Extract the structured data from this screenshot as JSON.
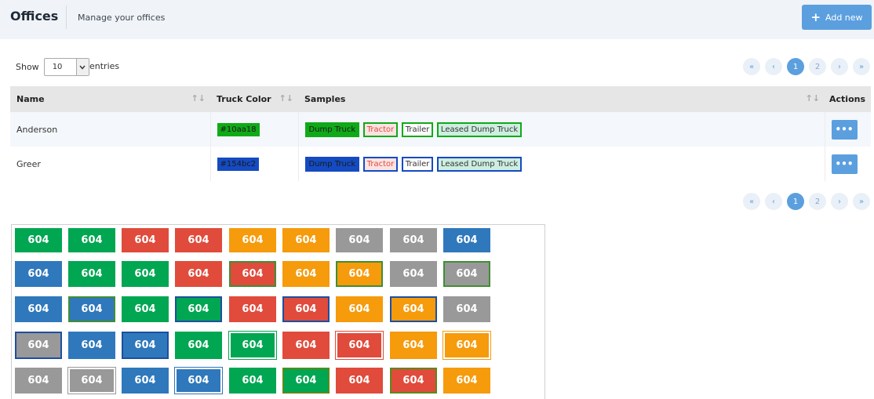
{
  "header": {
    "title": "Offices",
    "subtitle": "Manage your offices",
    "add_button_label": "Add new",
    "add_icon": "plus-icon"
  },
  "length": {
    "show_label": "Show",
    "value": "10",
    "entries_label": "entries"
  },
  "pagination": {
    "first_icon": "«",
    "prev_icon": "‹",
    "pages": [
      "1",
      "2"
    ],
    "active_page": "1",
    "next_icon": "›",
    "last_icon": "»"
  },
  "table": {
    "columns": [
      "Name",
      "Truck Color",
      "Samples",
      "Actions"
    ],
    "rows": [
      {
        "name": "Anderson",
        "truck_color": "#10aa18",
        "chip_bg": "#10aa18",
        "samples": [
          {
            "label": "Dump Truck",
            "bg": "#10aa18",
            "fg": "#1a1a1a",
            "border": "#10aa18"
          },
          {
            "label": "Tractor",
            "bg": "#fbe3e3",
            "fg": "#e04b3c",
            "border": "#10aa18"
          },
          {
            "label": "Trailer",
            "bg": "#ffffff",
            "fg": "#333333",
            "border": "#10aa18"
          },
          {
            "label": "Leased Dump Truck",
            "bg": "#cdeee0",
            "fg": "#333333",
            "border": "#10aa18"
          }
        ],
        "action_label": "•••"
      },
      {
        "name": "Greer",
        "truck_color": "#154bc2",
        "chip_bg": "#154bc2",
        "samples": [
          {
            "label": "Dump Truck",
            "bg": "#154bc2",
            "fg": "#1a1a1a",
            "border": "#154bc2"
          },
          {
            "label": "Tractor",
            "bg": "#fbe3e3",
            "fg": "#e04b3c",
            "border": "#154bc2"
          },
          {
            "label": "Trailer",
            "bg": "#ffffff",
            "fg": "#333333",
            "border": "#154bc2"
          },
          {
            "label": "Leased Dump Truck",
            "bg": "#cdeee0",
            "fg": "#333333",
            "border": "#154bc2"
          }
        ],
        "action_label": "•••"
      }
    ]
  },
  "swatch_label": "604",
  "swatch_rows": [
    [
      {
        "bg": "#00a651",
        "border": "none"
      },
      {
        "bg": "#00a651",
        "border": "none"
      },
      {
        "bg": "#e04b3c",
        "border": "none"
      },
      {
        "bg": "#e04b3c",
        "border": "none"
      },
      {
        "bg": "#f59b0c",
        "border": "none"
      },
      {
        "bg": "#f59b0c",
        "border": "none"
      },
      {
        "bg": "#999999",
        "border": "none"
      },
      {
        "bg": "#999999",
        "border": "none"
      },
      {
        "bg": "#2f78bc",
        "border": "none"
      }
    ],
    [
      {
        "bg": "#2f78bc",
        "border": "none"
      },
      {
        "bg": "#00a651",
        "border": "none"
      },
      {
        "bg": "#00a651",
        "border": "none"
      },
      {
        "bg": "#e04b3c",
        "border": "none"
      },
      {
        "bg": "#e04b3c",
        "border": "#3f8f33"
      },
      {
        "bg": "#f59b0c",
        "border": "none"
      },
      {
        "bg": "#f59b0c",
        "border": "#3f8f33"
      },
      {
        "bg": "#999999",
        "border": "none"
      },
      {
        "bg": "#999999",
        "border": "#3f8f33"
      }
    ],
    [
      {
        "bg": "#2f78bc",
        "border": "none"
      },
      {
        "bg": "#2f78bc",
        "border": "#3f8f33"
      },
      {
        "bg": "#00a651",
        "border": "none"
      },
      {
        "bg": "#00a651",
        "border": "#1d4fa0"
      },
      {
        "bg": "#e04b3c",
        "border": "none"
      },
      {
        "bg": "#e04b3c",
        "border": "#1d4fa0"
      },
      {
        "bg": "#f59b0c",
        "border": "none"
      },
      {
        "bg": "#f59b0c",
        "border": "#1d4fa0"
      },
      {
        "bg": "#999999",
        "border": "none"
      }
    ],
    [
      {
        "bg": "#999999",
        "border": "#1d4fa0"
      },
      {
        "bg": "#2f78bc",
        "border": "none"
      },
      {
        "bg": "#2f78bc",
        "border": "#1d4fa0"
      },
      {
        "bg": "#00a651",
        "border": "none"
      },
      {
        "bg": "#00a651",
        "border": "#ffffff"
      },
      {
        "bg": "#e04b3c",
        "border": "none"
      },
      {
        "bg": "#e04b3c",
        "border": "#ffffff"
      },
      {
        "bg": "#f59b0c",
        "border": "none"
      },
      {
        "bg": "#f59b0c",
        "border": "#ffffff"
      }
    ],
    [
      {
        "bg": "#999999",
        "border": "none"
      },
      {
        "bg": "#999999",
        "border": "#ffffff"
      },
      {
        "bg": "#2f78bc",
        "border": "none"
      },
      {
        "bg": "#2f78bc",
        "border": "#ffffff"
      },
      {
        "bg": "#00a651",
        "border": "none"
      },
      {
        "bg": "#00a651",
        "border": "#5a8a1a"
      },
      {
        "bg": "#e04b3c",
        "border": "none"
      },
      {
        "bg": "#e04b3c",
        "border": "#5a8a1a"
      },
      {
        "bg": "#f59b0c",
        "border": "none"
      }
    ]
  ]
}
